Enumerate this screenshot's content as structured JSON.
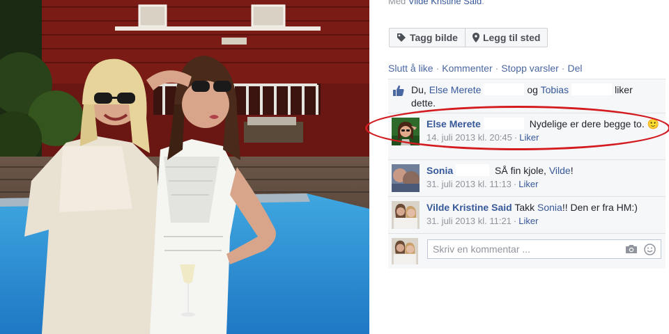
{
  "post": {
    "with_prefix": "Med",
    "with_name": "Vilde Kristine Said",
    "with_suffix": "."
  },
  "buttons": {
    "tag_photo": "Tagg bilde",
    "add_location": "Legg til sted"
  },
  "actions": {
    "unlike": "Slutt å like",
    "comment": "Kommenter",
    "stop_notifications": "Stopp varsler",
    "share": "Del",
    "separator": "·"
  },
  "likes": {
    "prefix": "Du,",
    "person1": "Else Merete",
    "and": "og",
    "person2": "Tobias",
    "suffix": "liker dette."
  },
  "comments": [
    {
      "author": "Else Merete",
      "text": "Nydelige er dere begge to.",
      "emoji": "🙂",
      "timestamp": "14. juli 2013 kl. 20:45",
      "like_label": "Liker"
    },
    {
      "author": "Sonia",
      "text_before": "SÅ fin kjole,",
      "mention": "Vilde",
      "text_after": "!",
      "timestamp": "31. juli 2013 kl. 11:13",
      "like_label": "Liker"
    },
    {
      "author": "Vilde Kristine Said",
      "text_before": "Takk",
      "mention": "Sonia",
      "text_after": "!! Den er fra HM:)",
      "timestamp": "31. juli 2013 kl. 11:21",
      "like_label": "Liker"
    }
  ],
  "composer": {
    "placeholder": "Skriv en kommentar ..."
  },
  "icons": {
    "tag": "tag-icon",
    "location": "map-pin-icon",
    "like": "thumbs-up-icon",
    "camera": "camera-icon",
    "emoji": "smiley-icon"
  },
  "colors": {
    "link": "#365899",
    "highlight_ring": "#d31b20",
    "feedback_bg": "#f6f7f9"
  }
}
